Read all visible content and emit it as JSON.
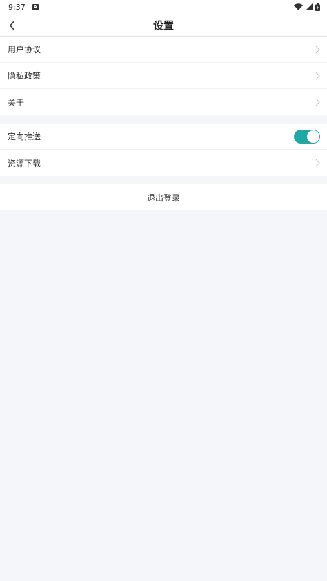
{
  "status_bar": {
    "time": "9:37",
    "notification_icon": "A"
  },
  "header": {
    "title": "设置",
    "back_icon": "chevron-left-icon"
  },
  "group1": {
    "items": [
      {
        "label": "用户协议"
      },
      {
        "label": "隐私政策"
      },
      {
        "label": "关于"
      }
    ]
  },
  "group2": {
    "push": {
      "label": "定向推送",
      "enabled": true
    },
    "download": {
      "label": "资源下载"
    }
  },
  "logout": {
    "label": "退出登录"
  },
  "colors": {
    "toggle_on": "#1fa9a2",
    "background": "#f5f6fa"
  }
}
